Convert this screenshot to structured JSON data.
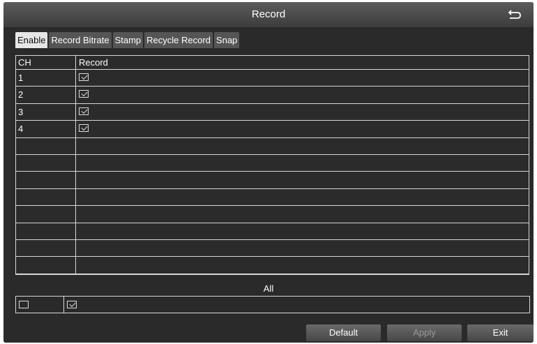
{
  "window": {
    "title": "Record"
  },
  "tabs": [
    {
      "label": "Enable",
      "active": true
    },
    {
      "label": "Record Bitrate",
      "active": false
    },
    {
      "label": "Stamp",
      "active": false
    },
    {
      "label": "Recycle Record",
      "active": false
    },
    {
      "label": "Snap",
      "active": false
    }
  ],
  "table": {
    "headers": {
      "ch": "CH",
      "record": "Record"
    },
    "rows": [
      {
        "ch": "1",
        "record_checked": true
      },
      {
        "ch": "2",
        "record_checked": true
      },
      {
        "ch": "3",
        "record_checked": true
      },
      {
        "ch": "4",
        "record_checked": true
      },
      {
        "ch": "",
        "record_checked": null
      },
      {
        "ch": "",
        "record_checked": null
      },
      {
        "ch": "",
        "record_checked": null
      },
      {
        "ch": "",
        "record_checked": null
      },
      {
        "ch": "",
        "record_checked": null
      },
      {
        "ch": "",
        "record_checked": null
      },
      {
        "ch": "",
        "record_checked": null
      },
      {
        "ch": "",
        "record_checked": null
      }
    ]
  },
  "all": {
    "label": "All",
    "ch_checked": false,
    "record_checked": true
  },
  "buttons": {
    "default": "Default",
    "apply": "Apply",
    "exit": "Exit"
  },
  "icons": {
    "back": "back-arrow-icon"
  },
  "colors": {
    "background": "#2a2a2a",
    "active_tab": "#e6e6e6",
    "grid_line": "#d8d8d8"
  }
}
